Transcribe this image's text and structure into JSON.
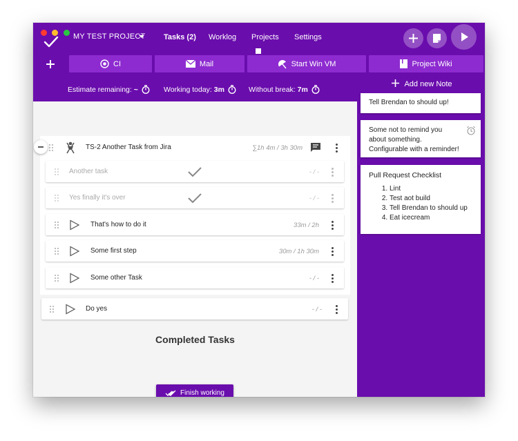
{
  "colors": {
    "primary": "#6a0dad",
    "button": "#8d2bd0",
    "dot_red": "#ff3b30",
    "dot_yellow": "#ffbd2e",
    "dot_green": "#28c940"
  },
  "header": {
    "project_name": "MY TEST PROJECT",
    "nav": [
      {
        "label": "Tasks (2)",
        "active": true
      },
      {
        "label": "Worklog"
      },
      {
        "label": "Projects"
      },
      {
        "label": "Settings"
      }
    ],
    "icons": [
      "add-icon",
      "note-icon",
      "play-icon"
    ]
  },
  "toolbar": {
    "add_icon": "add-icon",
    "buttons": [
      {
        "label": "CI",
        "icon": "radio-icon"
      },
      {
        "label": "Mail",
        "icon": "mail-icon"
      },
      {
        "label": "Start Win VM",
        "icon": "umbrella-icon"
      },
      {
        "label": "Project Wiki",
        "icon": "book-icon"
      }
    ]
  },
  "stats": {
    "estimate_label": "Estimate remaining:",
    "estimate_value": "~",
    "working_label": "Working today:",
    "working_value": "3m",
    "break_label": "Without break:",
    "break_value": "7m"
  },
  "notes": {
    "add_label": "Add new Note",
    "items": [
      {
        "text": "Tell Brendan to should up!"
      },
      {
        "line1": "Some not to remind you",
        "line2": "about something.",
        "line3": "Configurable with a reminder!"
      },
      {
        "title": "Pull Request Checklist",
        "list": [
          "Lint",
          "Test aot build",
          "Tell Brendan to should up",
          "Eat icecream"
        ]
      }
    ]
  },
  "tasks": {
    "parent": {
      "title": "TS-2 Another Task from Jira",
      "time": "∑1h 4m / 3h 30m"
    },
    "subtasks": [
      {
        "title": "Another task",
        "time": "- / -",
        "done": true
      },
      {
        "title": "Yes finally it's over",
        "time": "- / -",
        "done": true
      },
      {
        "title": "That's how to do it",
        "time": "33m / 2h",
        "done": false
      },
      {
        "title": "Some first step",
        "time": "30m / 1h 30m",
        "done": false
      },
      {
        "title": "Some other Task",
        "time": "- / -",
        "done": false
      }
    ],
    "standalone": {
      "title": "Do yes",
      "time": "- / -"
    }
  },
  "completed": {
    "title": "Completed Tasks"
  },
  "finish": {
    "label": "Finish working"
  },
  "fab": {
    "count": "2"
  }
}
